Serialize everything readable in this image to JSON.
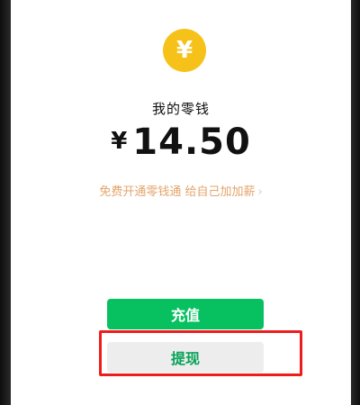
{
  "wallet": {
    "coin_symbol": "¥",
    "title": "我的零钱",
    "currency": "¥",
    "balance": "14.50",
    "promo_text": "免费开通零钱通 给自己加加薪",
    "promo_chevron": "›"
  },
  "actions": {
    "recharge_label": "充值",
    "withdraw_label": "提现"
  },
  "colors": {
    "accent_green": "#07c160",
    "coin_yellow": "#f6c21a",
    "promo_orange": "#e3a46a",
    "highlight_red": "#ee1c1c"
  }
}
